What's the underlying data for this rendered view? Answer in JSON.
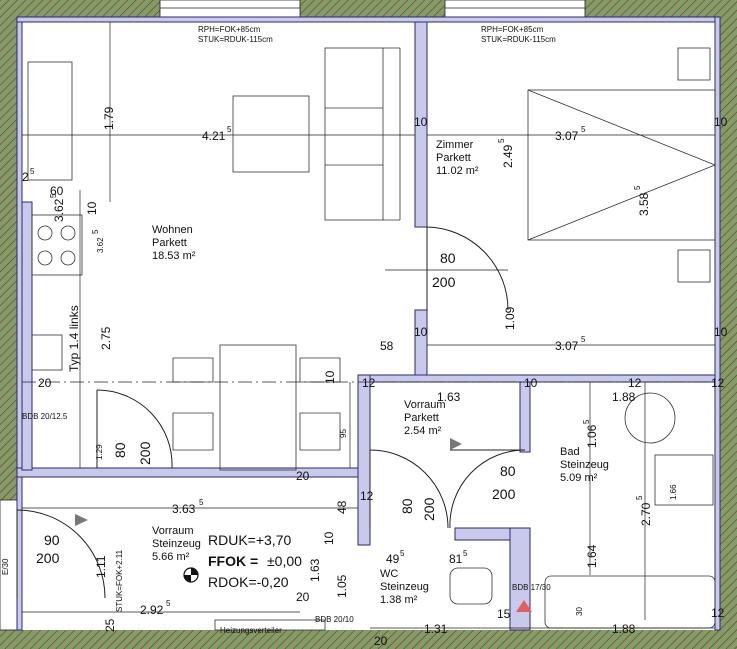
{
  "colors": {
    "wall_fill": "#c9c9ec",
    "wall_stroke": "#2a2a72",
    "exterior_wall": "#7f9f69",
    "line": "#222222",
    "accent": "#e06060"
  },
  "top_window_notes": {
    "left_1": "RPH=FOK+85cm",
    "left_2": "STUK=RDUK-115cm",
    "right_1": "RPH=FOK+85cm",
    "right_2": "STUK=RDUK-115cm"
  },
  "rooms": {
    "wohnen": {
      "name": "Wohnen",
      "floor": "Parkett",
      "area": "18.53 m²"
    },
    "zimmer": {
      "name": "Zimmer",
      "floor": "Parkett",
      "area": "11.02 m²"
    },
    "vorraum_top": {
      "name": "Vorraum",
      "floor": "Parkett",
      "area": "2.54 m²"
    },
    "bad": {
      "name": "Bad",
      "floor": "Steinzeug",
      "area": "5.09 m²"
    },
    "vorraum_bottom": {
      "name": "Vorraum",
      "floor": "Steinzeug",
      "area": "5.66 m²"
    },
    "wc": {
      "name": "WC",
      "floor": "Steinzeug",
      "area": "1.38 m²"
    }
  },
  "levels": {
    "rduk": "RDUK=+3,70",
    "ffok_label": "FFOK =",
    "ffok_value": "±0,00",
    "rdok": "RDOK=-0,20"
  },
  "fixtures": {
    "typ": "Typ 1.4 links",
    "bdb_left": "BDB 20/12.5",
    "bdb_right": "BDB 17/30",
    "heizungsverteiler": "Heizungsverteiler",
    "stuk": "STUK=FOK+2.11",
    "bottom_small": "BDB 20/10",
    "left_edge": "E/30"
  },
  "doors": {
    "zimmer_w": "80",
    "zimmer_h": "200",
    "wohnen_w": "80",
    "wohnen_h": "200",
    "bad_w": "80",
    "bad_h": "200",
    "wc_w": "80",
    "wc_h": "200",
    "entry_w": "90",
    "entry_h": "200"
  },
  "dimensions": {
    "wohnen_width": "4.21",
    "wohnen_width_sup": "5",
    "zimmer_width": "3.07",
    "zimmer_width_sup": "5",
    "zimmer_width_2": "3.07",
    "zimmer_width_2_sup": "5",
    "wohnen_top_depth": "1.79",
    "zimmer_depth": "2.49",
    "zimmer_depth_sup": "5",
    "zimmer_depth_2": "3.58",
    "zimmer_depth_2_sup": "5",
    "kitchen_60": "60",
    "kitchen_2": "2",
    "kitchen_2_sup": "5",
    "kitchen_362": "3.62",
    "kitchen_362_sup": "5",
    "kitchen_362_b": "3.62",
    "kitchen_362_b_sup": "5",
    "kitchen_10": "10",
    "kitchen_275": "2.75",
    "wall_10_a": "10",
    "wall_10_b": "10",
    "wall_10_c": "10",
    "wall_10_d": "10",
    "wall_10_e": "10",
    "wall_10_f": "10",
    "wall_10_g": "10",
    "door_109": "1.09",
    "dim_58": "58",
    "dim_12_a": "12",
    "dim_12_b": "12",
    "dim_12_c": "12",
    "dim_12_d": "12",
    "dim_12_e": "12",
    "dim_20_a": "20",
    "dim_20_b": "20",
    "dim_20_c": "20",
    "dim_20_d": "20",
    "dim_163": "1.63",
    "dim_188": "1.88",
    "dim_106": "1.06",
    "dim_106_sup": "5",
    "dim_270": "2.70",
    "dim_270_sup": "5",
    "dim_166": "1.66",
    "dim_95": "95",
    "dim_129": "1.29",
    "dim_363": "3.63",
    "dim_363_sup": "5",
    "dim_48": "48",
    "dim_163_b": "1.63",
    "dim_105": "1.05",
    "dim_49": "49",
    "dim_49_sup": "5",
    "dim_81": "81",
    "dim_81_sup": "5",
    "dim_164": "1.64",
    "dim_111": "1.11",
    "dim_292": "2.92",
    "dim_292_sup": "5",
    "dim_25": "25",
    "dim_30": "30",
    "dim_131": "1.31",
    "dim_15": "15",
    "dim_188_b": "1.88"
  }
}
